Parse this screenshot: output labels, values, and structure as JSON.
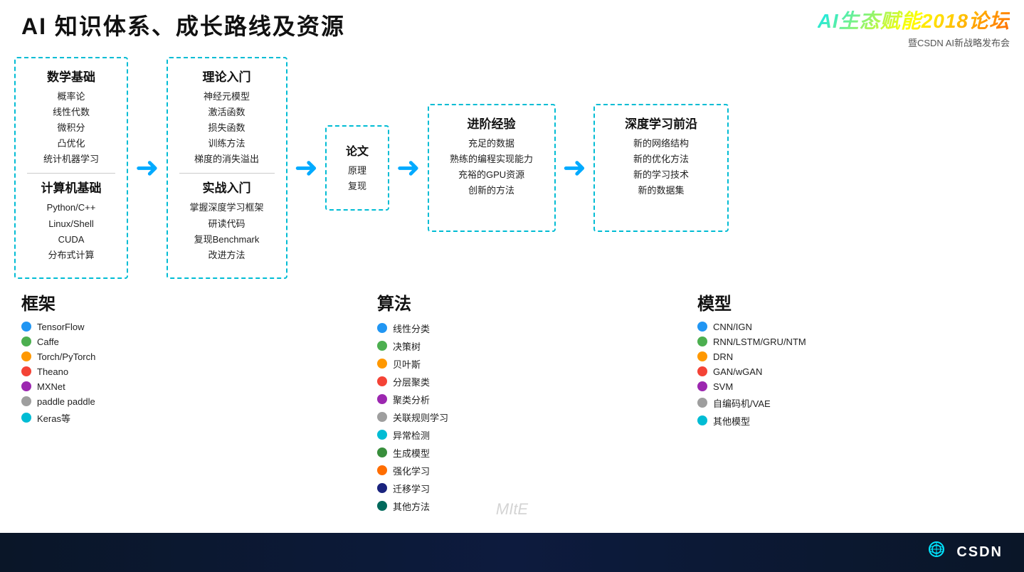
{
  "header": {
    "title": "AI 知识体系、成长路线及资源"
  },
  "brand": {
    "title": "AI生态赋能2018论坛",
    "subtitle": "暨CSDN AI新战略发布会"
  },
  "flow": {
    "box1": {
      "section1_title": "数学基础",
      "section1_items": [
        "概率论",
        "线性代数",
        "微积分",
        "凸优化",
        "统计机器学习"
      ],
      "section2_title": "计算机基础",
      "section2_items": [
        "Python/C++",
        "Linux/Shell",
        "CUDA",
        "分布式计算"
      ]
    },
    "box2": {
      "section1_title": "理论入门",
      "section1_items": [
        "神经元模型",
        "激活函数",
        "损失函数",
        "训练方法",
        "梯度的消失溢出"
      ],
      "section2_title": "实战入门",
      "section2_items": [
        "掌握深度学习框架",
        "研读代码",
        "复现Benchmark",
        "改进方法"
      ]
    },
    "box3": {
      "title": "论文",
      "lines": [
        "原理",
        "复现"
      ]
    },
    "box4": {
      "title": "进阶经验",
      "items": [
        "充足的数据",
        "熟练的编程实现能力",
        "充裕的GPU资源",
        "创新的方法"
      ]
    },
    "box5": {
      "title": "深度学习前沿",
      "items": [
        "新的网络结构",
        "新的优化方法",
        "新的学习技术",
        "新的数据集"
      ]
    }
  },
  "bottom": {
    "frameworks": {
      "title": "框架",
      "items": [
        {
          "color": "#2196F3",
          "label": "TensorFlow"
        },
        {
          "color": "#4CAF50",
          "label": "Caffe"
        },
        {
          "color": "#FF9800",
          "label": "Torch/PyTorch"
        },
        {
          "color": "#F44336",
          "label": "Theano"
        },
        {
          "color": "#9C27B0",
          "label": "MXNet"
        },
        {
          "color": "#9E9E9E",
          "label": "paddle paddle"
        },
        {
          "color": "#00BCD4",
          "label": "Keras等"
        }
      ]
    },
    "algorithms": {
      "title": "算法",
      "items": [
        {
          "color": "#2196F3",
          "label": "线性分类"
        },
        {
          "color": "#4CAF50",
          "label": "决策树"
        },
        {
          "color": "#FF9800",
          "label": "贝叶斯"
        },
        {
          "color": "#F44336",
          "label": "分层聚类"
        },
        {
          "color": "#9C27B0",
          "label": "聚类分析"
        },
        {
          "color": "#9E9E9E",
          "label": "关联规则学习"
        },
        {
          "color": "#00BCD4",
          "label": "异常检测"
        },
        {
          "color": "#388E3C",
          "label": "生成模型"
        },
        {
          "color": "#FF6D00",
          "label": "强化学习"
        },
        {
          "color": "#1A237E",
          "label": "迁移学习"
        },
        {
          "color": "#00695C",
          "label": "其他方法"
        }
      ]
    },
    "models": {
      "title": "模型",
      "items": [
        {
          "color": "#2196F3",
          "label": "CNN/IGN"
        },
        {
          "color": "#4CAF50",
          "label": "RNN/LSTM/GRU/NTM"
        },
        {
          "color": "#FF9800",
          "label": "DRN"
        },
        {
          "color": "#F44336",
          "label": "GAN/wGAN"
        },
        {
          "color": "#9C27B0",
          "label": "SVM"
        },
        {
          "color": "#9E9E9E",
          "label": "自编码机/VAE"
        },
        {
          "color": "#00BCD4",
          "label": "其他模型"
        }
      ]
    }
  },
  "watermark": "MItE",
  "csdn": "CSDN"
}
